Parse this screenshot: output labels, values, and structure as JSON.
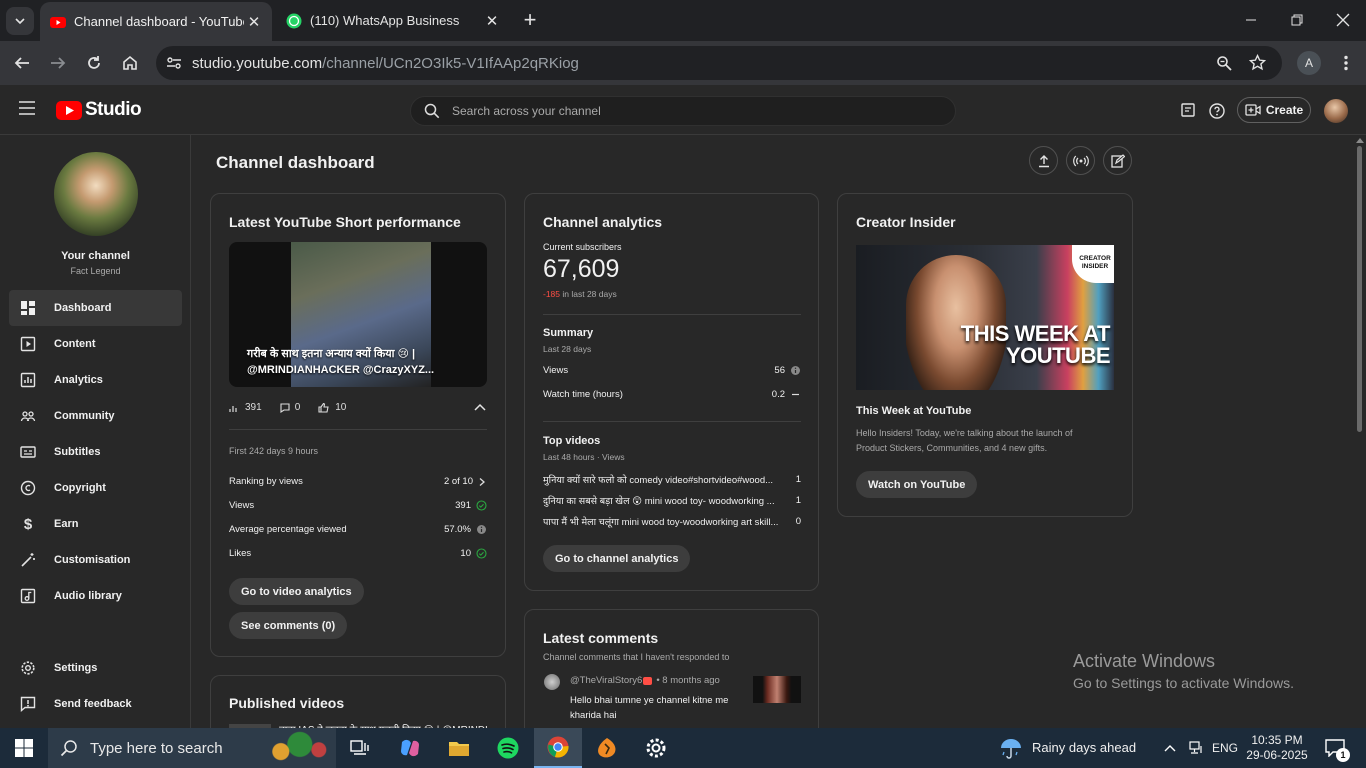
{
  "browser": {
    "tabs": [
      {
        "title": "Channel dashboard - YouTube S",
        "favicon": "youtube-studio-icon"
      },
      {
        "title": "(110) WhatsApp Business",
        "favicon": "whatsapp-icon"
      }
    ],
    "url_host": "studio.youtube.com",
    "url_path": "/channel/UCn2O3Ik5-V1IfAAp2qRKiog",
    "profile_initial": "A"
  },
  "studio": {
    "logo_text": "Studio",
    "search_placeholder": "Search across your channel",
    "create_label": "Create"
  },
  "sidebar": {
    "channel_title": "Your channel",
    "channel_name": "Fact Legend",
    "items": [
      {
        "label": "Dashboard",
        "icon": "dashboard-icon",
        "active": true
      },
      {
        "label": "Content",
        "icon": "content-icon"
      },
      {
        "label": "Analytics",
        "icon": "analytics-icon"
      },
      {
        "label": "Community",
        "icon": "community-icon"
      },
      {
        "label": "Subtitles",
        "icon": "subtitles-icon"
      },
      {
        "label": "Copyright",
        "icon": "copyright-icon"
      },
      {
        "label": "Earn",
        "icon": "earn-icon"
      },
      {
        "label": "Customisation",
        "icon": "customisation-icon"
      },
      {
        "label": "Audio library",
        "icon": "audio-library-icon"
      }
    ],
    "bottom_items": [
      {
        "label": "Settings",
        "icon": "settings-icon"
      },
      {
        "label": "Send feedback",
        "icon": "feedback-icon"
      }
    ]
  },
  "dashboard": {
    "title": "Channel dashboard",
    "short_card": {
      "title": "Latest YouTube Short performance",
      "caption_line1": "गरीब के साथ इतना अन्याय क्यों किया 😢 |",
      "caption_line2": "@MRINDIANHACKER @CrazyXYZ...",
      "views": "391",
      "comments": "0",
      "likes": "10",
      "period": "First 242 days 9 hours",
      "metrics": [
        {
          "label": "Ranking by views",
          "value": "2 of 10"
        },
        {
          "label": "Views",
          "value": "391"
        },
        {
          "label": "Average percentage viewed",
          "value": "57.0%"
        },
        {
          "label": "Likes",
          "value": "10"
        }
      ],
      "btn_analytics": "Go to video analytics",
      "btn_comments": "See comments (0)"
    },
    "published": {
      "title": "Published videos",
      "first_item": "बाबा IAS ने जनता के साथ गलती किया 😢 | @MRINDI..."
    },
    "analytics_card": {
      "title": "Channel analytics",
      "subs_label": "Current subscribers",
      "subs_value": "67,609",
      "subs_delta": "-185",
      "subs_delta_suffix": "in last 28 days",
      "summary_title": "Summary",
      "summary_period": "Last 28 days",
      "summary_rows": [
        {
          "label": "Views",
          "value": "56"
        },
        {
          "label": "Watch time (hours)",
          "value": "0.2"
        }
      ],
      "top_title": "Top videos",
      "top_period": "Last 48 hours · Views",
      "top_videos": [
        {
          "title": "मुनिया क्यों सारे फलो को comedy video#shortvideo#wood...",
          "views": "1"
        },
        {
          "title": "दुनिया का सबसे बड़ा खेल 😲 mini wood toy- woodworking ...",
          "views": "1"
        },
        {
          "title": "पापा मैं भी मेला चलूंगा mini wood toy-woodworking art skill...",
          "views": "0"
        }
      ],
      "btn": "Go to channel analytics"
    },
    "comments_card": {
      "title": "Latest comments",
      "subtitle": "Channel comments that I haven't responded to",
      "author": "@TheViralStory6",
      "time": "• 8 months ago",
      "text_line1": "Hello bhai tumne ye channel kitne me",
      "text_line2": "kharida hai"
    },
    "insider_card": {
      "title": "Creator Insider",
      "badge": "CREATOR INSIDER",
      "thumb_text": "THIS WEEK AT YOUTUBE",
      "video_title": "This Week at YouTube",
      "desc_line1": "Hello Insiders! Today, we're talking about the launch of",
      "desc_line2": "Product Stickers, Communities, and 4 new gifts.",
      "btn": "Watch on YouTube"
    }
  },
  "watermark": {
    "line1": "Activate Windows",
    "line2": "Go to Settings to activate Windows."
  },
  "taskbar": {
    "search_text": "Type here to search",
    "weather": "Rainy days ahead",
    "lang": "ENG",
    "time": "10:35 PM",
    "date": "29-06-2025",
    "notification_count": "1"
  },
  "colors": {
    "youtube_red": "#ff0000",
    "negative": "#ff4e45",
    "success": "#2ba640"
  }
}
